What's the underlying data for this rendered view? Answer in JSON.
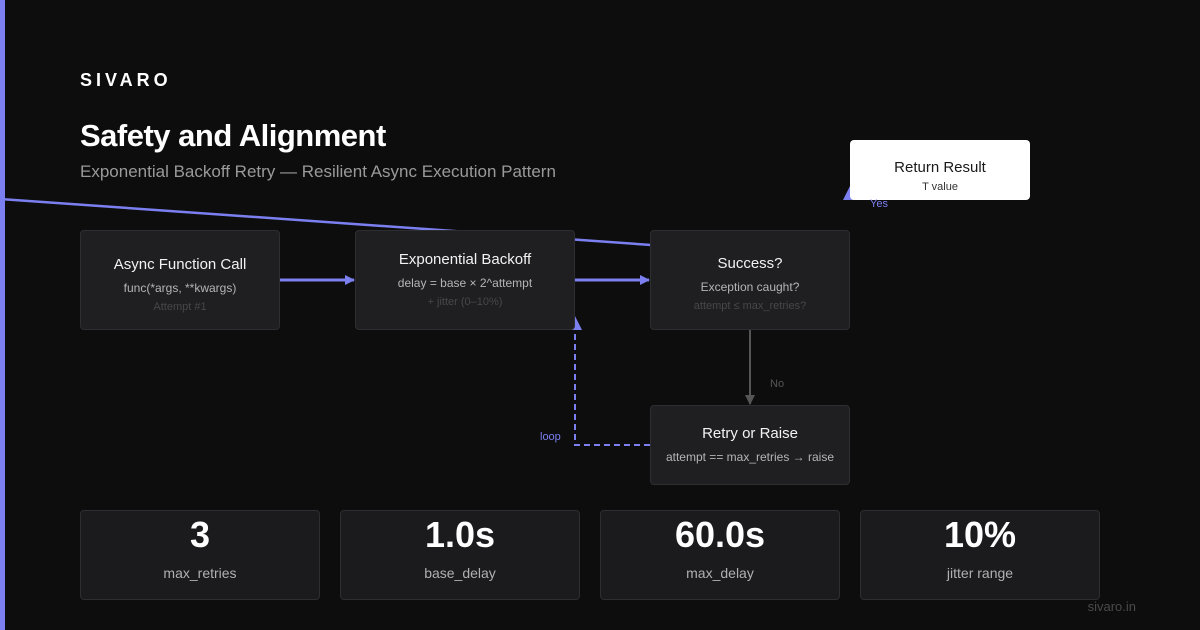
{
  "brand": "SIVARO",
  "title": "Safety and Alignment",
  "subtitle": "Exponential Backoff Retry — Resilient Async Execution Pattern",
  "nodes": {
    "call": {
      "title": "Async Function Call",
      "sub": "func(*args, **kwargs)",
      "hint": "Attempt #1"
    },
    "backoff": {
      "title": "Exponential Backoff",
      "sub": "delay = base × 2^attempt",
      "hint": "+ jitter (0–10%)"
    },
    "success": {
      "title": "Success?",
      "sub": "Exception caught?",
      "hint": "attempt ≤ max_retries?"
    },
    "retry": {
      "title": "Retry or Raise",
      "sub": "attempt == max_retries → raise"
    },
    "result": {
      "title": "Return Result",
      "sub": "T value"
    }
  },
  "edges": {
    "yes": "Yes",
    "no": "No",
    "loop": "loop"
  },
  "stats": [
    {
      "value": "3",
      "label": "max_retries"
    },
    {
      "value": "1.0s",
      "label": "base_delay"
    },
    {
      "value": "60.0s",
      "label": "max_delay"
    },
    {
      "value": "10%",
      "label": "jitter range"
    }
  ],
  "footer": "sivaro.in",
  "colors": {
    "background": "#0d0d0d",
    "accent": "#7b7ff0",
    "node_bg": "#1f1f21",
    "node_border": "#2e2e32",
    "no_arrow": "#555555"
  }
}
